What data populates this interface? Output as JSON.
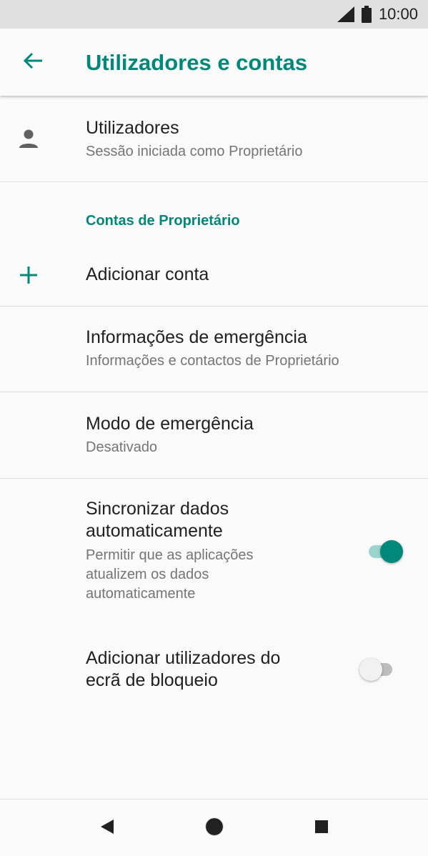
{
  "status_bar": {
    "time": "10:00",
    "icons": [
      "signal-icon",
      "battery-icon"
    ]
  },
  "app_bar": {
    "title": "Utilizadores e contas",
    "back_icon": "arrow-left-icon"
  },
  "colors": {
    "accent": "#00897b",
    "accent_light": "#9dd4cd",
    "text_primary": "#212121",
    "text_secondary": "#757575"
  },
  "items": {
    "users": {
      "title": "Utilizadores",
      "subtitle": "Sessão iniciada como Proprietário",
      "icon": "person-icon"
    },
    "section_header": "Contas de Proprietário",
    "add_account": {
      "title": "Adicionar conta",
      "icon": "plus-icon"
    },
    "emergency_info": {
      "title": "Informações de emergência",
      "subtitle": "Informações e contactos de Proprietário"
    },
    "emergency_mode": {
      "title": "Modo de emergência",
      "subtitle": "Desativado"
    },
    "auto_sync": {
      "title_line1": "Sincronizar dados",
      "title_line2": "automaticamente",
      "subtitle_line1": "Permitir que as aplicações",
      "subtitle_line2": "atualizem os dados",
      "subtitle_line3": "automaticamente",
      "enabled": true
    },
    "lockscreen_users": {
      "title_line1": "Adicionar utilizadores do",
      "title_line2": "ecrã de bloqueio",
      "enabled": false
    }
  },
  "nav_bar": {
    "buttons": [
      "back-triangle-icon",
      "home-circle-icon",
      "recents-square-icon"
    ]
  }
}
